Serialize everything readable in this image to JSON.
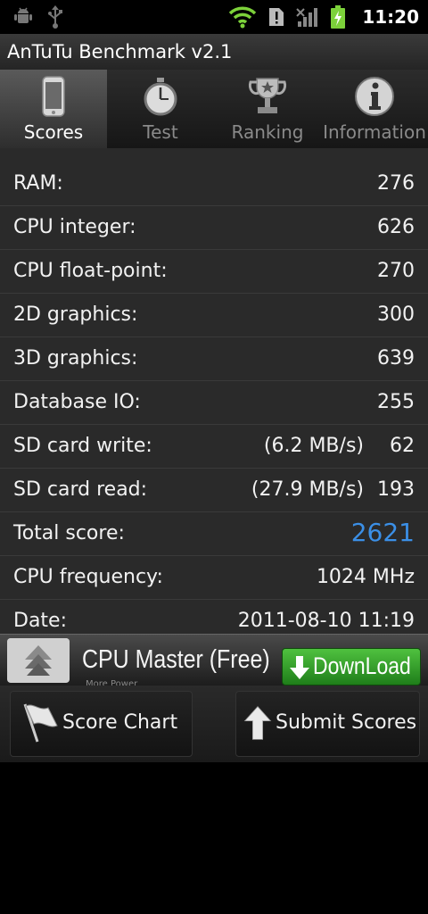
{
  "status_bar": {
    "left_icons": [
      "android-icon",
      "usb-icon"
    ],
    "right_icons": [
      "wifi-icon",
      "sim-alert-icon",
      "signal-icon",
      "battery-icon"
    ],
    "time": "11:20"
  },
  "app": {
    "title": "AnTuTu Benchmark v2.1"
  },
  "tabs": [
    {
      "label": "Scores",
      "icon": "phone-icon",
      "active": true
    },
    {
      "label": "Test",
      "icon": "stopwatch-icon",
      "active": false
    },
    {
      "label": "Ranking",
      "icon": "trophy-icon",
      "active": false
    },
    {
      "label": "Information",
      "icon": "info-icon",
      "active": false
    }
  ],
  "scores": [
    {
      "label": "RAM:",
      "value": "276"
    },
    {
      "label": "CPU integer:",
      "value": "626"
    },
    {
      "label": "CPU float-point:",
      "value": "270"
    },
    {
      "label": "2D graphics:",
      "value": "300"
    },
    {
      "label": "3D graphics:",
      "value": "639"
    },
    {
      "label": "Database IO:",
      "value": "255"
    },
    {
      "label": "SD card write:",
      "speed": "(6.2 MB/s)",
      "value": "62"
    },
    {
      "label": "SD card read:",
      "speed": "(27.9 MB/s)",
      "value": "193"
    },
    {
      "label": "Total score:",
      "value": "2621",
      "color": "#3b8fe6"
    },
    {
      "label": "CPU frequency:",
      "value": "1024 MHz"
    },
    {
      "label": "Date:",
      "value": "2011-08-10 11:19"
    }
  ],
  "ad": {
    "title": "CPU Master (Free)",
    "subtitle": "More Power",
    "download_label": "DownLoad",
    "download_color": "#3aa82e"
  },
  "buttons": {
    "score_chart": "Score Chart",
    "submit_scores": "Submit Scores"
  }
}
